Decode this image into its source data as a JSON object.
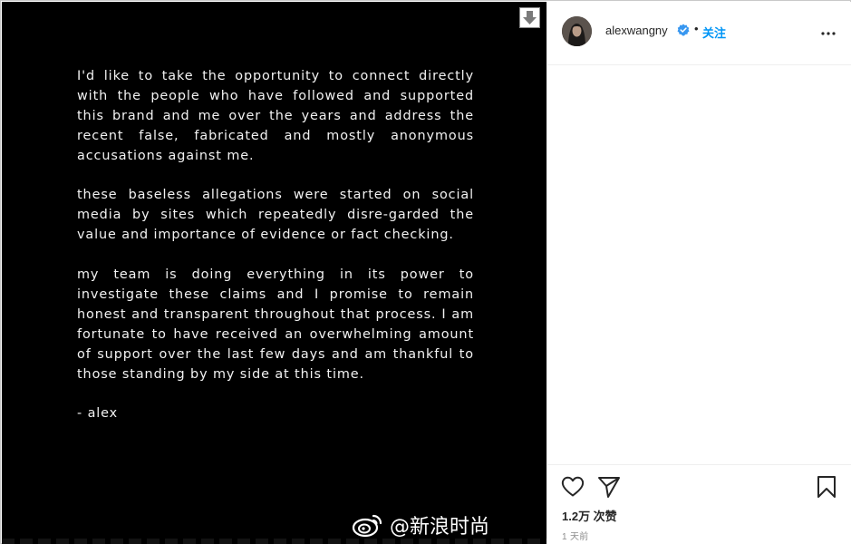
{
  "statement": {
    "paragraphs": [
      "I'd like to take the opportunity to connect directly with the people who have followed and supported this brand and me over the years and address the recent false, fabricated and mostly anonymous accusations against me.",
      "these baseless allegations were started on social media by sites which repeatedly disre-garded the value and importance of evidence or fact checking.",
      "my team is doing everything in its power to investigate these claims and I promise to remain honest and transparent throughout that process. I am fortunate to have received an overwhelming amount of support over the last few days and am thankful to those standing by my side at this time."
    ],
    "signature": "- alex"
  },
  "watermark": {
    "text": "@新浪时尚",
    "icon": "weibo-icon"
  },
  "header": {
    "username": "alexwangny",
    "separator": "•",
    "follow_label": "关注"
  },
  "engagement": {
    "likes_text": "1.2万 次赞",
    "time_text": "1 天前"
  },
  "icons": {
    "download": "download-arrow-icon",
    "verified": "verified-badge-icon",
    "more": "more-options-icon",
    "like": "heart-icon",
    "share": "paper-plane-icon",
    "save": "bookmark-icon"
  },
  "colors": {
    "accent": "#0095f6",
    "text": "#262626",
    "muted": "#8e8e8e",
    "image_bg": "#000000"
  }
}
